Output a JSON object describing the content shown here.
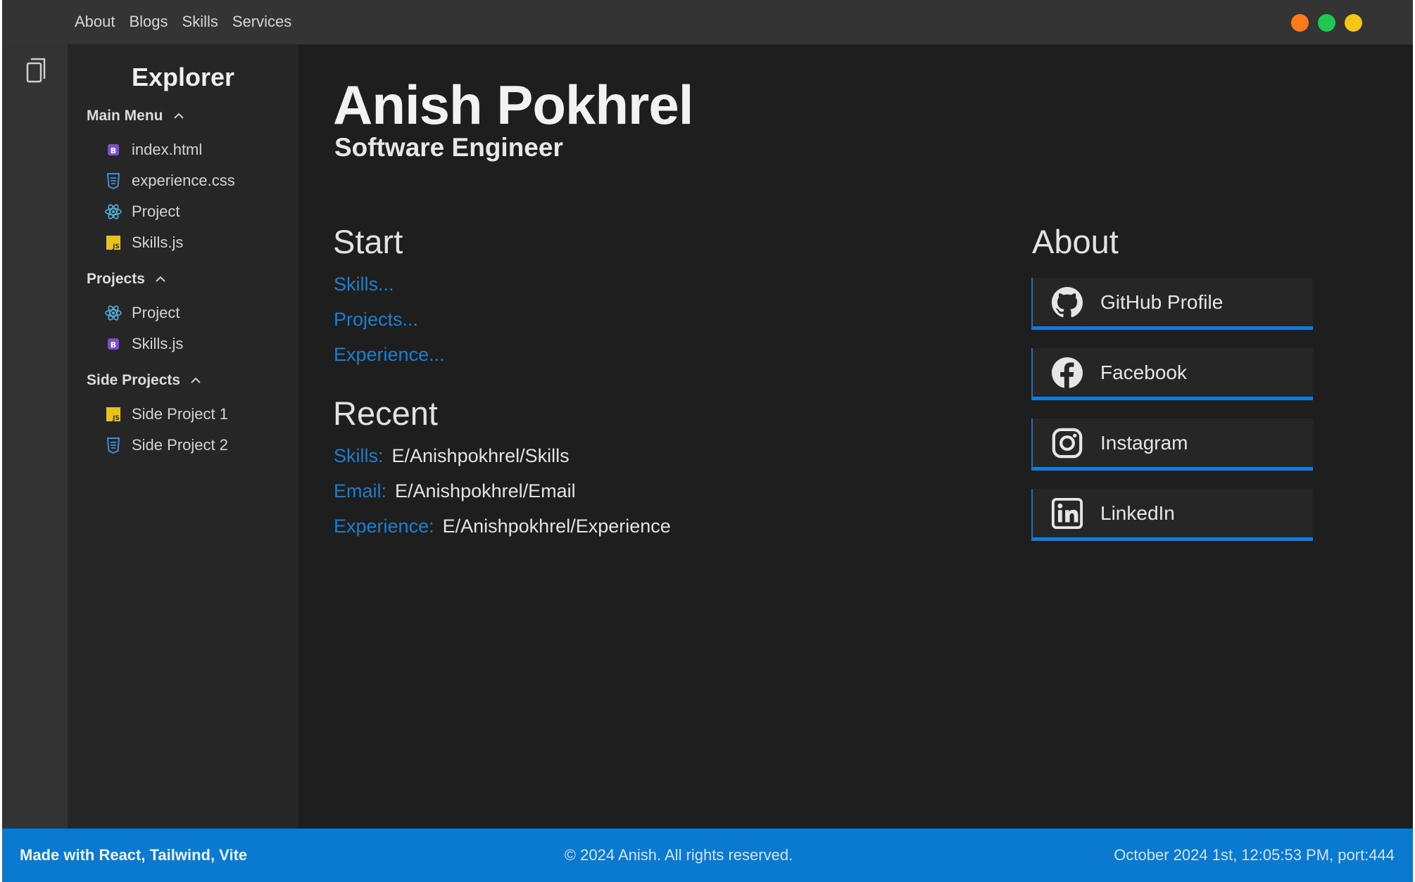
{
  "nav": {
    "items": [
      "About",
      "Blogs",
      "Skills",
      "Services"
    ]
  },
  "window_controls": {
    "colors": [
      "#ff7a1a",
      "#1fc94f",
      "#f5c518"
    ]
  },
  "activity_bar": {
    "icon": "files-icon"
  },
  "explorer": {
    "title": "Explorer",
    "sections": [
      {
        "label": "Main Menu",
        "files": [
          {
            "name": "index.html",
            "icon": "bootstrap-file-icon"
          },
          {
            "name": "experience.css",
            "icon": "css-file-icon"
          },
          {
            "name": "Project",
            "icon": "react-file-icon"
          },
          {
            "name": "Skills.js",
            "icon": "js-file-icon"
          }
        ]
      },
      {
        "label": "Projects",
        "files": [
          {
            "name": "Project",
            "icon": "react-file-icon"
          },
          {
            "name": "Skills.js",
            "icon": "bootstrap-file-icon"
          }
        ]
      },
      {
        "label": "Side Projects",
        "files": [
          {
            "name": "Side Project 1",
            "icon": "js-file-icon"
          },
          {
            "name": "Side Project 2",
            "icon": "css-file-icon"
          }
        ]
      }
    ]
  },
  "main": {
    "name": "Anish Pokhrel",
    "role": "Software Engineer",
    "start": {
      "title": "Start",
      "links": [
        "Skills...",
        "Projects...",
        "Experience..."
      ]
    },
    "recent": {
      "title": "Recent",
      "items": [
        {
          "key": "Skills:",
          "value": "E/Anishpokhrel/Skills"
        },
        {
          "key": "Email:",
          "value": "E/Anishpokhrel/Email"
        },
        {
          "key": "Experience:",
          "value": "E/Anishpokhrel/Experience"
        }
      ]
    },
    "about": {
      "title": "About",
      "links": [
        {
          "label": "GitHub Profile",
          "icon": "github-icon"
        },
        {
          "label": "Facebook",
          "icon": "facebook-icon"
        },
        {
          "label": "Instagram",
          "icon": "instagram-icon"
        },
        {
          "label": "LinkedIn",
          "icon": "linkedin-icon"
        }
      ]
    }
  },
  "status_bar": {
    "left": "Made with React, Tailwind, Vite",
    "center": "© 2024 Anish. All rights reserved.",
    "right": "October 2024 1st, 12:05:53 PM, port:444"
  },
  "colors": {
    "accent": "#0a7ad0",
    "link": "#1a7fd0",
    "background": "#1e1e1e",
    "sidebar": "#262626"
  }
}
